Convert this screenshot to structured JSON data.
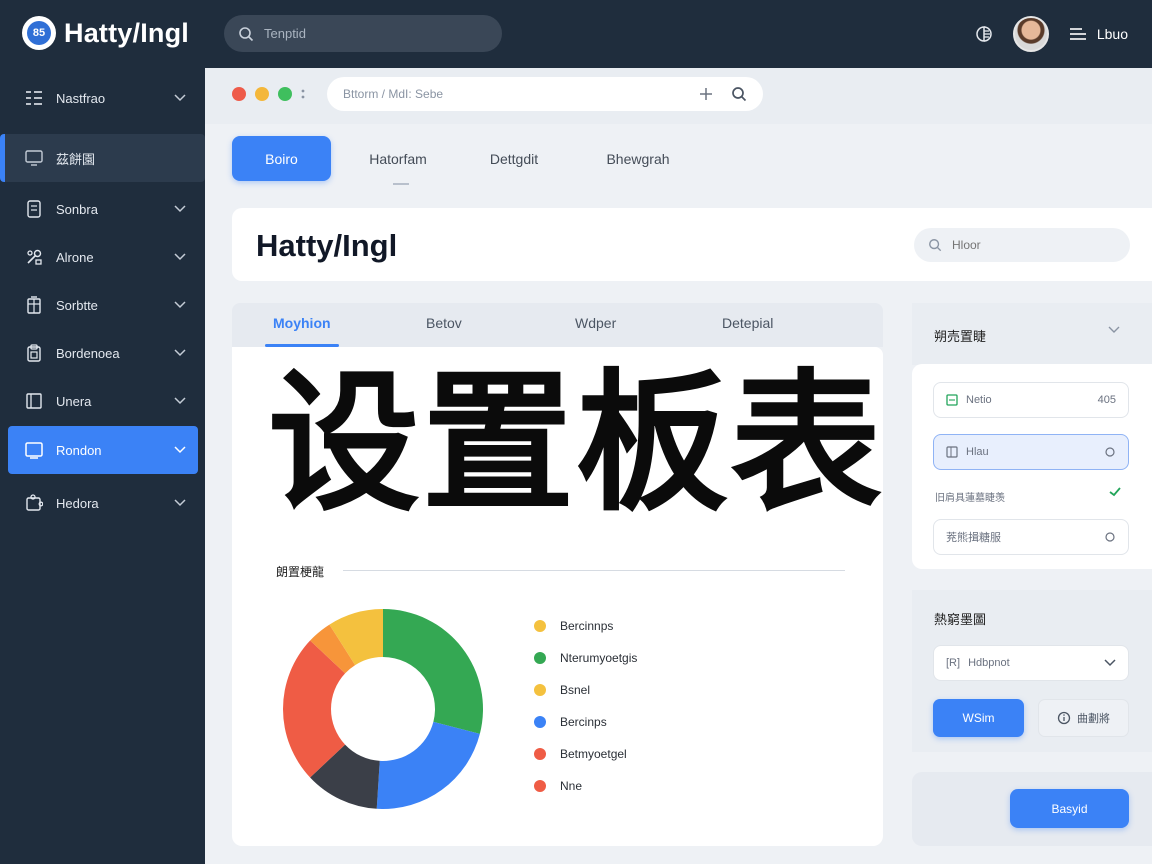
{
  "app": {
    "title": "Hatty/Ingl",
    "logo_mark": "85"
  },
  "topbar": {
    "search": {
      "placeholder": "Tenptid"
    },
    "user": {
      "label": "Lbuo"
    },
    "icons": [
      "search-icon",
      "theme-icon",
      "menu-icon"
    ]
  },
  "sidebar": {
    "items": [
      {
        "label": "Nastfrao",
        "icon": "list-icon",
        "has_chevron": true,
        "state": "normal"
      },
      {
        "label": "茲餅園",
        "icon": "monitor-icon",
        "has_chevron": false,
        "state": "highlight"
      },
      {
        "label": "Sonbra",
        "icon": "document-icon",
        "has_chevron": true,
        "state": "normal"
      },
      {
        "label": "Alrone",
        "icon": "tools-icon",
        "has_chevron": true,
        "state": "normal"
      },
      {
        "label": "Sorbtte",
        "icon": "building-icon",
        "has_chevron": true,
        "state": "normal"
      },
      {
        "label": "Bordenoea",
        "icon": "clipboard-icon",
        "has_chevron": true,
        "state": "normal"
      },
      {
        "label": "Unera",
        "icon": "book-icon",
        "has_chevron": true,
        "state": "normal"
      },
      {
        "label": "Rondon",
        "icon": "tablet-icon",
        "has_chevron": true,
        "state": "active"
      },
      {
        "label": "Hedora",
        "icon": "puzzle-icon",
        "has_chevron": true,
        "state": "normal"
      }
    ]
  },
  "browser": {
    "url": "Bttorm / MdI: Sebe",
    "window_dots": [
      "#ee5b4a",
      "#f4b73a",
      "#3fbf5e"
    ]
  },
  "tabs": [
    {
      "label": "Boiro",
      "active": true
    },
    {
      "label": "Hatorfam",
      "active": false
    },
    {
      "label": "Dettgdit",
      "active": false
    },
    {
      "label": "Bhewgrah",
      "active": false
    }
  ],
  "header": {
    "title": "Hatty/Ingl",
    "search_placeholder": "Hloor"
  },
  "content_tabs": [
    {
      "label": "Moyhion",
      "active": true
    },
    {
      "label": "Betov",
      "active": false
    },
    {
      "label": "Wdper",
      "active": false
    },
    {
      "label": "Detepial",
      "active": false
    }
  ],
  "main": {
    "big_title": "设置板表",
    "section_label": "朗置梗龍"
  },
  "chart_data": {
    "type": "pie",
    "donut": true,
    "categories": [
      "Bercinnps",
      "Nterumyoetgis",
      "Bsnel",
      "Bercinps",
      "Betmyoetgel",
      "Nne"
    ],
    "values": [
      29,
      22,
      12,
      24,
      4,
      9
    ],
    "slice_colors": [
      "#34a853",
      "#3b82f6",
      "#3b3f48",
      "#ef5c45",
      "#f7953a",
      "#f4c13e"
    ],
    "legend": [
      {
        "label": "Bercinnps",
        "color": "#f4c13e"
      },
      {
        "label": "Nterumyoetgis",
        "color": "#34a853"
      },
      {
        "label": "Bsnel",
        "color": "#f4c13e"
      },
      {
        "label": "Bercinps",
        "color": "#3b82f6"
      },
      {
        "label": "Betmyoetgel",
        "color": "#ef5c45"
      },
      {
        "label": "Nne",
        "color": "#ef5c45"
      }
    ],
    "legend_position": "right"
  },
  "right_panel": {
    "header_title": "朔売置睫",
    "field1": {
      "label": "Netio",
      "value": "405"
    },
    "field2": {
      "label": "Hlau"
    },
    "row_text": "旧肩具蓮墓睫羡",
    "field3": {
      "label": "茺熊揖糖服"
    },
    "section2_title": "熱窮墨圖",
    "select": {
      "label": "Hdbpnot",
      "prefix": "[R]"
    },
    "btn_primary": "WSim",
    "btn_secondary": "曲劃將",
    "btn_footer": "Basyid"
  },
  "colors": {
    "accent": "#3b82f6",
    "topbar_bg": "#1f2d3d",
    "sidebar_bg": "#1f2d3d",
    "page_bg": "#eef1f5"
  }
}
